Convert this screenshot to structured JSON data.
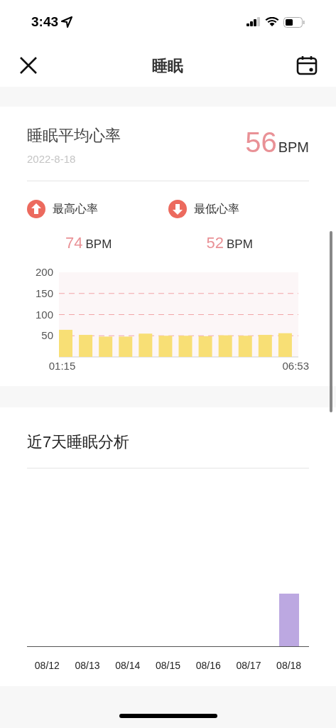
{
  "status_bar": {
    "time": "3:43"
  },
  "header": {
    "title": "睡眠"
  },
  "heart_rate_card": {
    "title": "睡眠平均心率",
    "date": "2022-8-18",
    "value": "56",
    "unit": "BPM",
    "stats": [
      {
        "kind": "max",
        "label": "最高心率",
        "value": "74",
        "unit": "BPM"
      },
      {
        "kind": "min",
        "label": "最低心率",
        "value": "52",
        "unit": "BPM"
      }
    ],
    "chart_data": {
      "type": "bar",
      "categories": [
        "01:15",
        null,
        null,
        null,
        null,
        null,
        null,
        null,
        null,
        null,
        null,
        "06:53"
      ],
      "values": [
        64,
        52,
        48,
        48,
        55,
        50,
        50,
        49,
        51,
        50,
        52,
        56
      ],
      "ylim": [
        0,
        200
      ],
      "yticks": [
        50,
        100,
        150,
        200
      ],
      "grid": true
    }
  },
  "sleep_card": {
    "title": "近7天睡眠分析",
    "days": [
      {
        "label": "08/12",
        "recorded": false
      },
      {
        "label": "08/13",
        "recorded": false
      },
      {
        "label": "08/14",
        "recorded": false
      },
      {
        "label": "08/15",
        "recorded": false
      },
      {
        "label": "08/16",
        "recorded": false
      },
      {
        "label": "08/17",
        "recorded": false
      },
      {
        "label": "08/18",
        "recorded": true
      }
    ]
  }
}
